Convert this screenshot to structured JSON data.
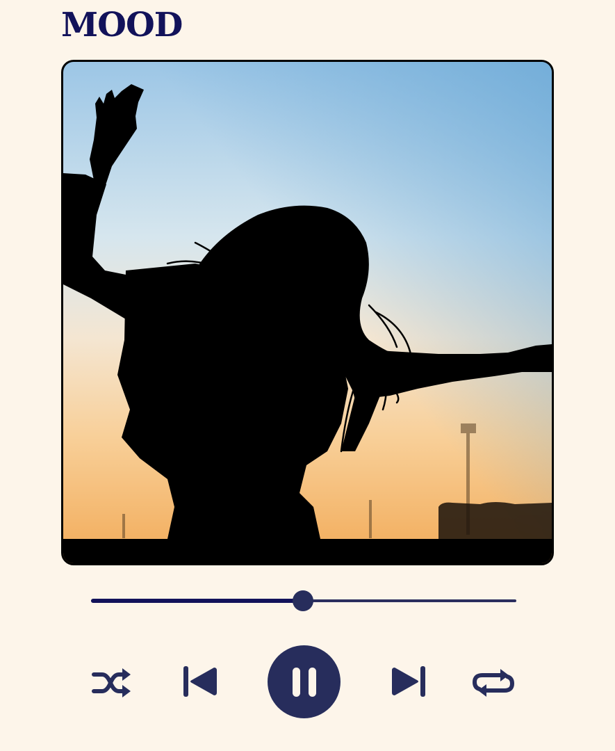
{
  "app": {
    "title": "MOOD"
  },
  "cover": {
    "description_icon": "album-art"
  },
  "player": {
    "progress_fraction": 0.498,
    "is_playing": true
  },
  "controls": {
    "shuffle_icon": "shuffle-icon",
    "previous_icon": "skip-previous-icon",
    "play_pause_icon": "pause-icon",
    "next_icon": "skip-next-icon",
    "repeat_icon": "repeat-icon"
  },
  "colors": {
    "background": "#fdf5ea",
    "accent": "#272d5c",
    "title": "#12125a"
  }
}
